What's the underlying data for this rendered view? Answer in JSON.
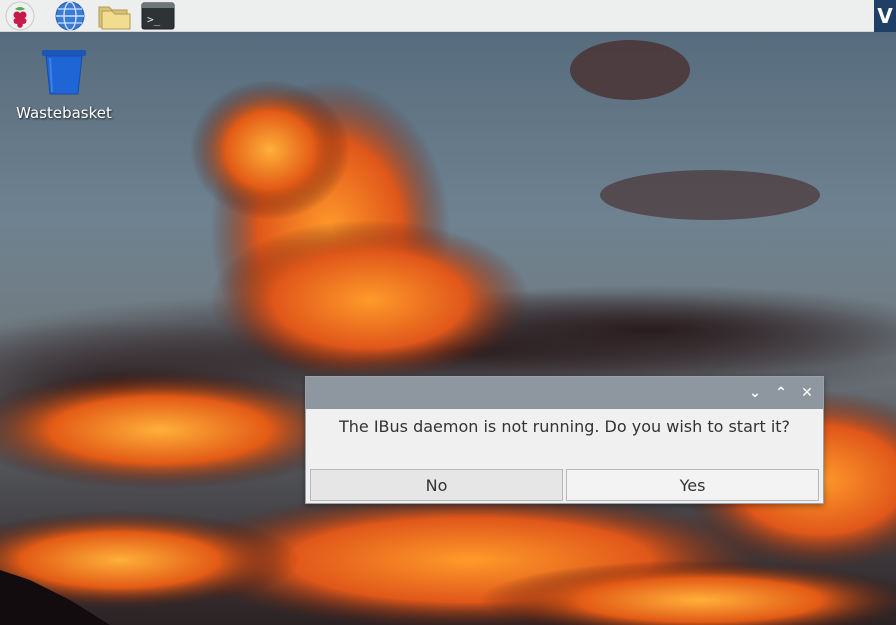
{
  "taskbar": {
    "launchers": [
      {
        "name": "raspberry-menu-icon"
      },
      {
        "name": "web-browser-icon"
      },
      {
        "name": "file-manager-icon"
      },
      {
        "name": "terminal-icon"
      }
    ],
    "terminal_glyph": ">_",
    "right_app_glyph": "V"
  },
  "desktop": {
    "icons": [
      {
        "label": "Wastebasket",
        "icon": "trash-bin-icon"
      }
    ]
  },
  "dialog": {
    "message": "The IBus daemon is not running. Do you wish to start it?",
    "buttons": {
      "no_label": "No",
      "yes_label": "Yes"
    },
    "titlebar_controls": {
      "minimize_glyph": "⌄",
      "maximize_glyph": "⌃",
      "close_glyph": "✕"
    }
  },
  "colors": {
    "taskbar_bg": "#edeeee",
    "dialog_titlebar": "#8e979f",
    "dialog_bg": "#f0f0f0",
    "trash_blue": "#1f65d6"
  }
}
